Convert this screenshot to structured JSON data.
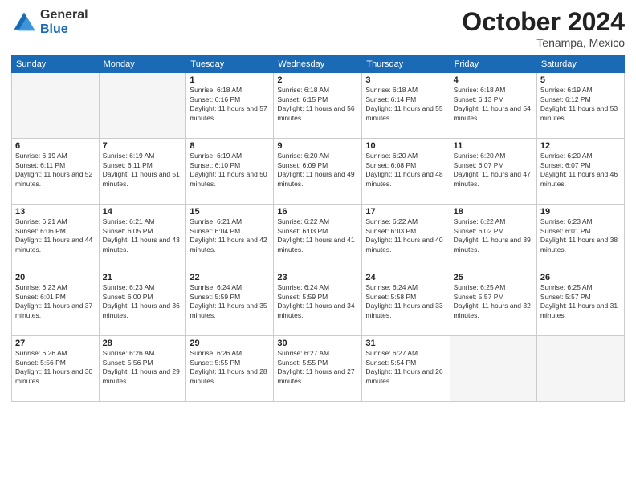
{
  "logo": {
    "general": "General",
    "blue": "Blue"
  },
  "header": {
    "month": "October 2024",
    "location": "Tenampa, Mexico"
  },
  "days_of_week": [
    "Sunday",
    "Monday",
    "Tuesday",
    "Wednesday",
    "Thursday",
    "Friday",
    "Saturday"
  ],
  "weeks": [
    [
      {
        "day": "",
        "empty": true
      },
      {
        "day": "",
        "empty": true
      },
      {
        "day": "1",
        "sunrise": "6:18 AM",
        "sunset": "6:16 PM",
        "daylight": "11 hours and 57 minutes."
      },
      {
        "day": "2",
        "sunrise": "6:18 AM",
        "sunset": "6:15 PM",
        "daylight": "11 hours and 56 minutes."
      },
      {
        "day": "3",
        "sunrise": "6:18 AM",
        "sunset": "6:14 PM",
        "daylight": "11 hours and 55 minutes."
      },
      {
        "day": "4",
        "sunrise": "6:18 AM",
        "sunset": "6:13 PM",
        "daylight": "11 hours and 54 minutes."
      },
      {
        "day": "5",
        "sunrise": "6:19 AM",
        "sunset": "6:12 PM",
        "daylight": "11 hours and 53 minutes."
      }
    ],
    [
      {
        "day": "6",
        "sunrise": "6:19 AM",
        "sunset": "6:11 PM",
        "daylight": "11 hours and 52 minutes."
      },
      {
        "day": "7",
        "sunrise": "6:19 AM",
        "sunset": "6:11 PM",
        "daylight": "11 hours and 51 minutes."
      },
      {
        "day": "8",
        "sunrise": "6:19 AM",
        "sunset": "6:10 PM",
        "daylight": "11 hours and 50 minutes."
      },
      {
        "day": "9",
        "sunrise": "6:20 AM",
        "sunset": "6:09 PM",
        "daylight": "11 hours and 49 minutes."
      },
      {
        "day": "10",
        "sunrise": "6:20 AM",
        "sunset": "6:08 PM",
        "daylight": "11 hours and 48 minutes."
      },
      {
        "day": "11",
        "sunrise": "6:20 AM",
        "sunset": "6:07 PM",
        "daylight": "11 hours and 47 minutes."
      },
      {
        "day": "12",
        "sunrise": "6:20 AM",
        "sunset": "6:07 PM",
        "daylight": "11 hours and 46 minutes."
      }
    ],
    [
      {
        "day": "13",
        "sunrise": "6:21 AM",
        "sunset": "6:06 PM",
        "daylight": "11 hours and 44 minutes."
      },
      {
        "day": "14",
        "sunrise": "6:21 AM",
        "sunset": "6:05 PM",
        "daylight": "11 hours and 43 minutes."
      },
      {
        "day": "15",
        "sunrise": "6:21 AM",
        "sunset": "6:04 PM",
        "daylight": "11 hours and 42 minutes."
      },
      {
        "day": "16",
        "sunrise": "6:22 AM",
        "sunset": "6:03 PM",
        "daylight": "11 hours and 41 minutes."
      },
      {
        "day": "17",
        "sunrise": "6:22 AM",
        "sunset": "6:03 PM",
        "daylight": "11 hours and 40 minutes."
      },
      {
        "day": "18",
        "sunrise": "6:22 AM",
        "sunset": "6:02 PM",
        "daylight": "11 hours and 39 minutes."
      },
      {
        "day": "19",
        "sunrise": "6:23 AM",
        "sunset": "6:01 PM",
        "daylight": "11 hours and 38 minutes."
      }
    ],
    [
      {
        "day": "20",
        "sunrise": "6:23 AM",
        "sunset": "6:01 PM",
        "daylight": "11 hours and 37 minutes."
      },
      {
        "day": "21",
        "sunrise": "6:23 AM",
        "sunset": "6:00 PM",
        "daylight": "11 hours and 36 minutes."
      },
      {
        "day": "22",
        "sunrise": "6:24 AM",
        "sunset": "5:59 PM",
        "daylight": "11 hours and 35 minutes."
      },
      {
        "day": "23",
        "sunrise": "6:24 AM",
        "sunset": "5:59 PM",
        "daylight": "11 hours and 34 minutes."
      },
      {
        "day": "24",
        "sunrise": "6:24 AM",
        "sunset": "5:58 PM",
        "daylight": "11 hours and 33 minutes."
      },
      {
        "day": "25",
        "sunrise": "6:25 AM",
        "sunset": "5:57 PM",
        "daylight": "11 hours and 32 minutes."
      },
      {
        "day": "26",
        "sunrise": "6:25 AM",
        "sunset": "5:57 PM",
        "daylight": "11 hours and 31 minutes."
      }
    ],
    [
      {
        "day": "27",
        "sunrise": "6:26 AM",
        "sunset": "5:56 PM",
        "daylight": "11 hours and 30 minutes."
      },
      {
        "day": "28",
        "sunrise": "6:26 AM",
        "sunset": "5:56 PM",
        "daylight": "11 hours and 29 minutes."
      },
      {
        "day": "29",
        "sunrise": "6:26 AM",
        "sunset": "5:55 PM",
        "daylight": "11 hours and 28 minutes."
      },
      {
        "day": "30",
        "sunrise": "6:27 AM",
        "sunset": "5:55 PM",
        "daylight": "11 hours and 27 minutes."
      },
      {
        "day": "31",
        "sunrise": "6:27 AM",
        "sunset": "5:54 PM",
        "daylight": "11 hours and 26 minutes."
      },
      {
        "day": "",
        "empty": true
      },
      {
        "day": "",
        "empty": true
      }
    ]
  ],
  "labels": {
    "sunrise": "Sunrise:",
    "sunset": "Sunset:",
    "daylight": "Daylight:"
  }
}
